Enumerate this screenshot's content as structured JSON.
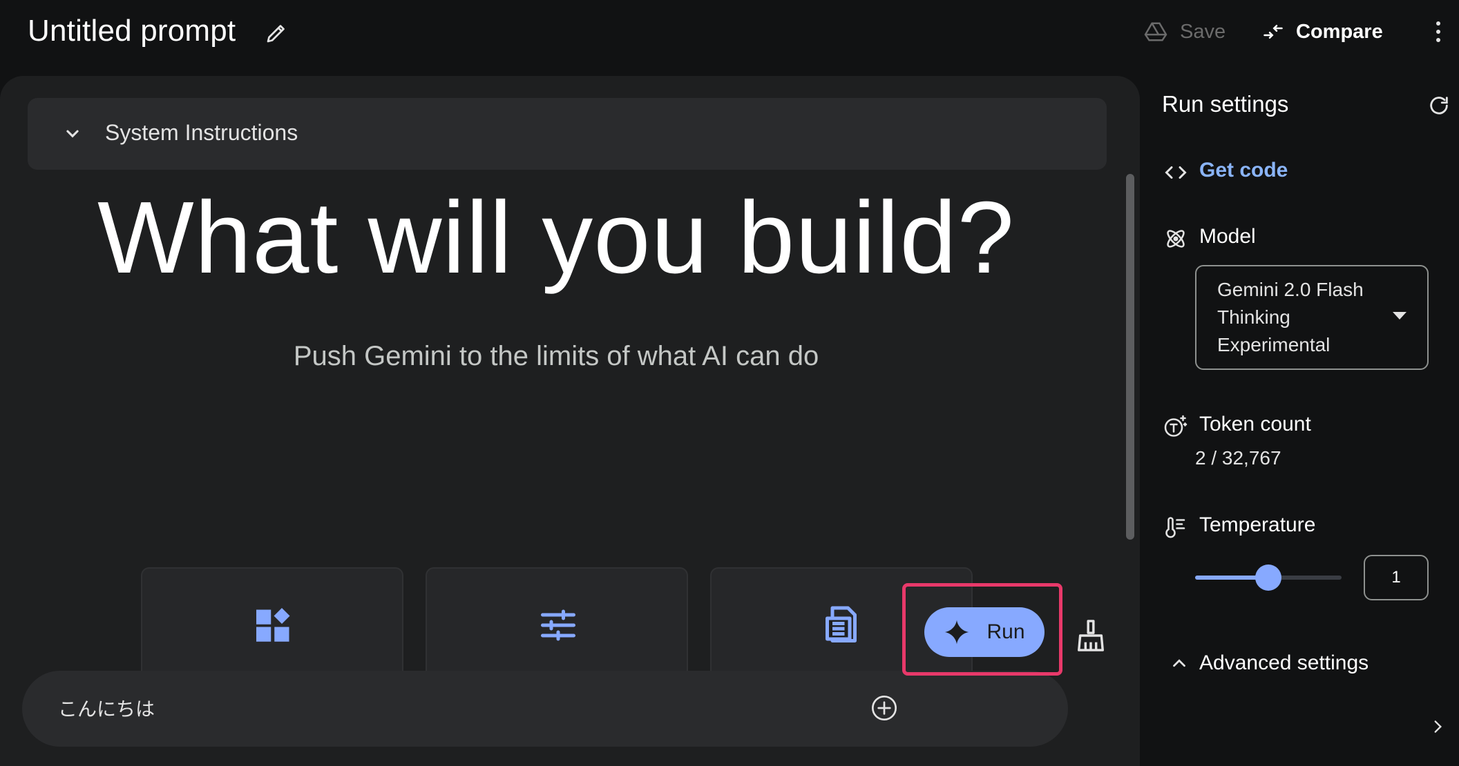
{
  "header": {
    "title": "Untitled prompt",
    "save_label": "Save",
    "compare_label": "Compare"
  },
  "system_instructions": {
    "label": "System Instructions"
  },
  "hero": {
    "headline": "What will you build?",
    "subheadline": "Push Gemini to the limits of what AI can do"
  },
  "cards": [
    {
      "icon": "widgets-icon"
    },
    {
      "icon": "tune-sliders-icon"
    },
    {
      "icon": "document-icon"
    }
  ],
  "prompt_input": {
    "value": "こんにちは"
  },
  "run_button": {
    "label": "Run"
  },
  "settings": {
    "title": "Run settings",
    "get_code_label": "Get code",
    "model_label": "Model",
    "model_value": "Gemini 2.0 Flash Thinking Experimental",
    "token_count_label": "Token count",
    "token_count_value": "2 / 32,767",
    "temperature_label": "Temperature",
    "temperature_value": "1",
    "temperature_level": 0.5,
    "advanced_label": "Advanced settings"
  },
  "colors": {
    "accent": "#87a9ff",
    "link": "#8ab4f8",
    "highlight": "#e8396a",
    "background": "#111213",
    "panel": "#1e1f20"
  }
}
